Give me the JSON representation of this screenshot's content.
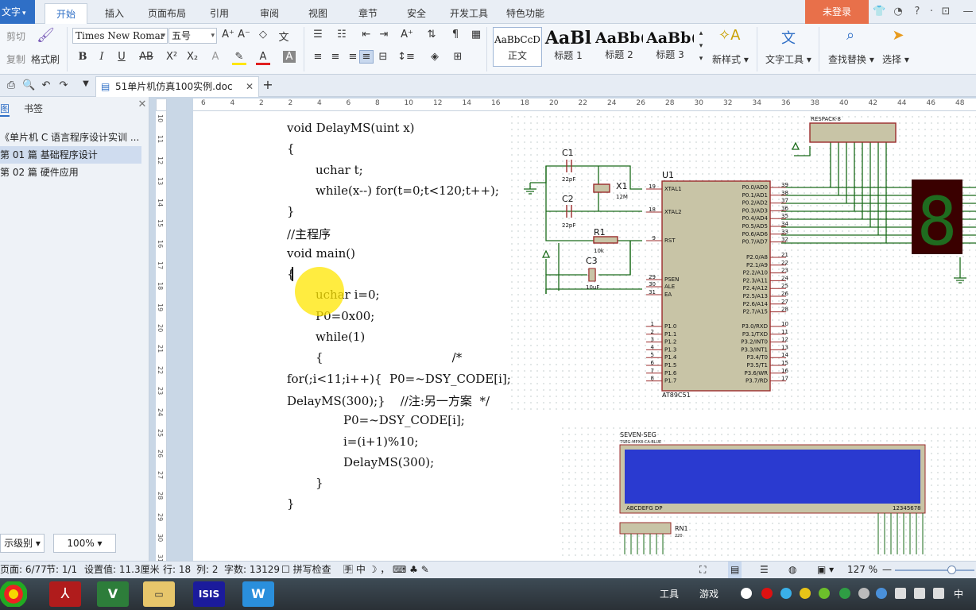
{
  "menubar": {
    "app_button": "文字",
    "items": [
      "开始",
      "插入",
      "页面布局",
      "引用",
      "审阅",
      "视图",
      "章节",
      "安全",
      "开发工具",
      "特色功能"
    ],
    "login": "未登录"
  },
  "ribbon": {
    "cut": "剪切",
    "copy": "复制",
    "format_painter": "格式刷",
    "font_name": "Times New Romar",
    "font_size": "五号",
    "styles": [
      {
        "sample": "AaBbCcD",
        "name": "正文"
      },
      {
        "sample": "AaBl",
        "name": "标题 1"
      },
      {
        "sample": "AaBb(",
        "name": "标题 2"
      },
      {
        "sample": "AaBb(",
        "name": "标题 3"
      }
    ],
    "new_style": "新样式",
    "text_tools": "文字工具",
    "find_replace": "查找替换",
    "select": "选择"
  },
  "tabbar": {
    "doc_tab": "51单片机仿真100实例.doc",
    "add_tab": "+"
  },
  "sidepanel": {
    "tab_toc": "图",
    "tab_bookmarks": "书签",
    "toc_items": [
      "《单片机 C 语言程序设计实训 ...",
      "第 01 篇  基础程序设计",
      "第 02 篇    硬件应用"
    ],
    "level_select": "示级别",
    "zoom_select": "100%"
  },
  "hruler_ticks": [
    "6",
    "4",
    "2",
    "2",
    "4",
    "6",
    "8",
    "10",
    "12",
    "14",
    "16",
    "18",
    "20",
    "22",
    "24",
    "26",
    "28",
    "30",
    "32",
    "34",
    "36",
    "38",
    "40",
    "42",
    "44",
    "46",
    "48"
  ],
  "vruler_ticks": [
    "10",
    "11",
    "12",
    "13",
    "14",
    "15",
    "16",
    "17",
    "18",
    "19",
    "20",
    "21",
    "22",
    "23",
    "24",
    "25",
    "26",
    "27",
    "28",
    "29",
    "30",
    "31"
  ],
  "document": {
    "code_lines": [
      {
        "text": "void DelayMS(uint x)",
        "indent": 0
      },
      {
        "text": "{",
        "indent": 0
      },
      {
        "text": "uchar t;",
        "indent": 1
      },
      {
        "text": "while(x--) for(t=0;t<120;t++);",
        "indent": 1
      },
      {
        "text": "}",
        "indent": 0
      },
      {
        "text": "//主程序",
        "indent": 0
      },
      {
        "text": "void main()",
        "indent": 0
      },
      {
        "text": "{",
        "indent": 0
      },
      {
        "text": "uchar i=0;",
        "indent": 1
      },
      {
        "text": "P0=0x00;",
        "indent": 1
      },
      {
        "text": "while(1)",
        "indent": 1
      },
      {
        "text": "{                                  /*",
        "indent": 1
      },
      {
        "text": "for(;i<11;i++){  P0=~DSY_CODE[i];",
        "indent": 0
      },
      {
        "text": "DelayMS(300);}    //注:另一方案  */",
        "indent": 0
      },
      {
        "text": "P0=~DSY_CODE[i];",
        "indent": 2
      },
      {
        "text": "i=(i+1)%10;",
        "indent": 2
      },
      {
        "text": "DelayMS(300);",
        "indent": 2
      },
      {
        "text": "}",
        "indent": 1
      },
      {
        "text": "}",
        "indent": 0
      }
    ]
  },
  "schematic": {
    "respack_label": "RESPACK-8",
    "c1": "C1",
    "c1_val": "22pF",
    "c2": "C2",
    "c2_val": "22pF",
    "x1": "X1",
    "x1_val": "12M",
    "r1": "R1",
    "r1_val": "10k",
    "c3": "C3",
    "c3_val": "10uF",
    "u1": "U1",
    "chip_name": "AT89C51",
    "left_pins": [
      {
        "num": "19",
        "name": "XTAL1"
      },
      {
        "num": "18",
        "name": "XTAL2"
      },
      {
        "num": "9",
        "name": "RST"
      },
      {
        "num": "29",
        "name": "PSEN"
      },
      {
        "num": "30",
        "name": "ALE"
      },
      {
        "num": "31",
        "name": "EA"
      }
    ],
    "p1_pins": [
      {
        "num": "1",
        "name": "P1.0"
      },
      {
        "num": "2",
        "name": "P1.1"
      },
      {
        "num": "3",
        "name": "P1.2"
      },
      {
        "num": "4",
        "name": "P1.3"
      },
      {
        "num": "5",
        "name": "P1.4"
      },
      {
        "num": "6",
        "name": "P1.5"
      },
      {
        "num": "7",
        "name": "P1.6"
      },
      {
        "num": "8",
        "name": "P1.7"
      }
    ],
    "p0_pins": [
      {
        "num": "39",
        "name": "P0.0/AD0"
      },
      {
        "num": "38",
        "name": "P0.1/AD1"
      },
      {
        "num": "37",
        "name": "P0.2/AD2"
      },
      {
        "num": "36",
        "name": "P0.3/AD3"
      },
      {
        "num": "35",
        "name": "P0.4/AD4"
      },
      {
        "num": "34",
        "name": "P0.5/AD5"
      },
      {
        "num": "33",
        "name": "P0.6/AD6"
      },
      {
        "num": "32",
        "name": "P0.7/AD7"
      }
    ],
    "p2_pins": [
      {
        "num": "21",
        "name": "P2.0/A8"
      },
      {
        "num": "22",
        "name": "P2.1/A9"
      },
      {
        "num": "23",
        "name": "P2.2/A10"
      },
      {
        "num": "24",
        "name": "P2.3/A11"
      },
      {
        "num": "25",
        "name": "P2.4/A12"
      },
      {
        "num": "26",
        "name": "P2.5/A13"
      },
      {
        "num": "27",
        "name": "P2.6/A14"
      },
      {
        "num": "28",
        "name": "P2.7/A15"
      }
    ],
    "p3_pins": [
      {
        "num": "10",
        "name": "P3.0/RXD"
      },
      {
        "num": "11",
        "name": "P3.1/TXD"
      },
      {
        "num": "12",
        "name": "P3.2/INT0"
      },
      {
        "num": "13",
        "name": "P3.3/INT1"
      },
      {
        "num": "14",
        "name": "P3.4/T0"
      },
      {
        "num": "15",
        "name": "P3.5/T1"
      },
      {
        "num": "16",
        "name": "P3.6/WR"
      },
      {
        "num": "17",
        "name": "P3.7/RD"
      }
    ],
    "seven_seg_digit": "8",
    "seg_title": "SEVEN-SEG",
    "seg_subtitle": "7SEG-MPX8-CA-BLUE",
    "seg_left_label": "ABCDEFG  DP",
    "seg_right_label": "12345678",
    "rn1": "RN1",
    "rn1_val": "220"
  },
  "statusbar": {
    "page": "页面: 6/77",
    "section": "节: 1/1",
    "setting": "设置值: 11.3厘米",
    "row": "行: 18",
    "col": "列: 2",
    "words": "字数: 13129",
    "spellcheck": "拼写检查",
    "zoom": "127 %"
  },
  "taskbar": {
    "tools": "工具",
    "games": "游戏"
  },
  "colors": {
    "accent": "#2f6fc6",
    "login_bg": "#e8704a",
    "chip_fill": "#c8c4a6",
    "chip_border": "#9b2c2c",
    "wire": "#1a6b1a",
    "lcd_blue": "#2a3ad0",
    "segment_green": "#1f6b1f"
  }
}
